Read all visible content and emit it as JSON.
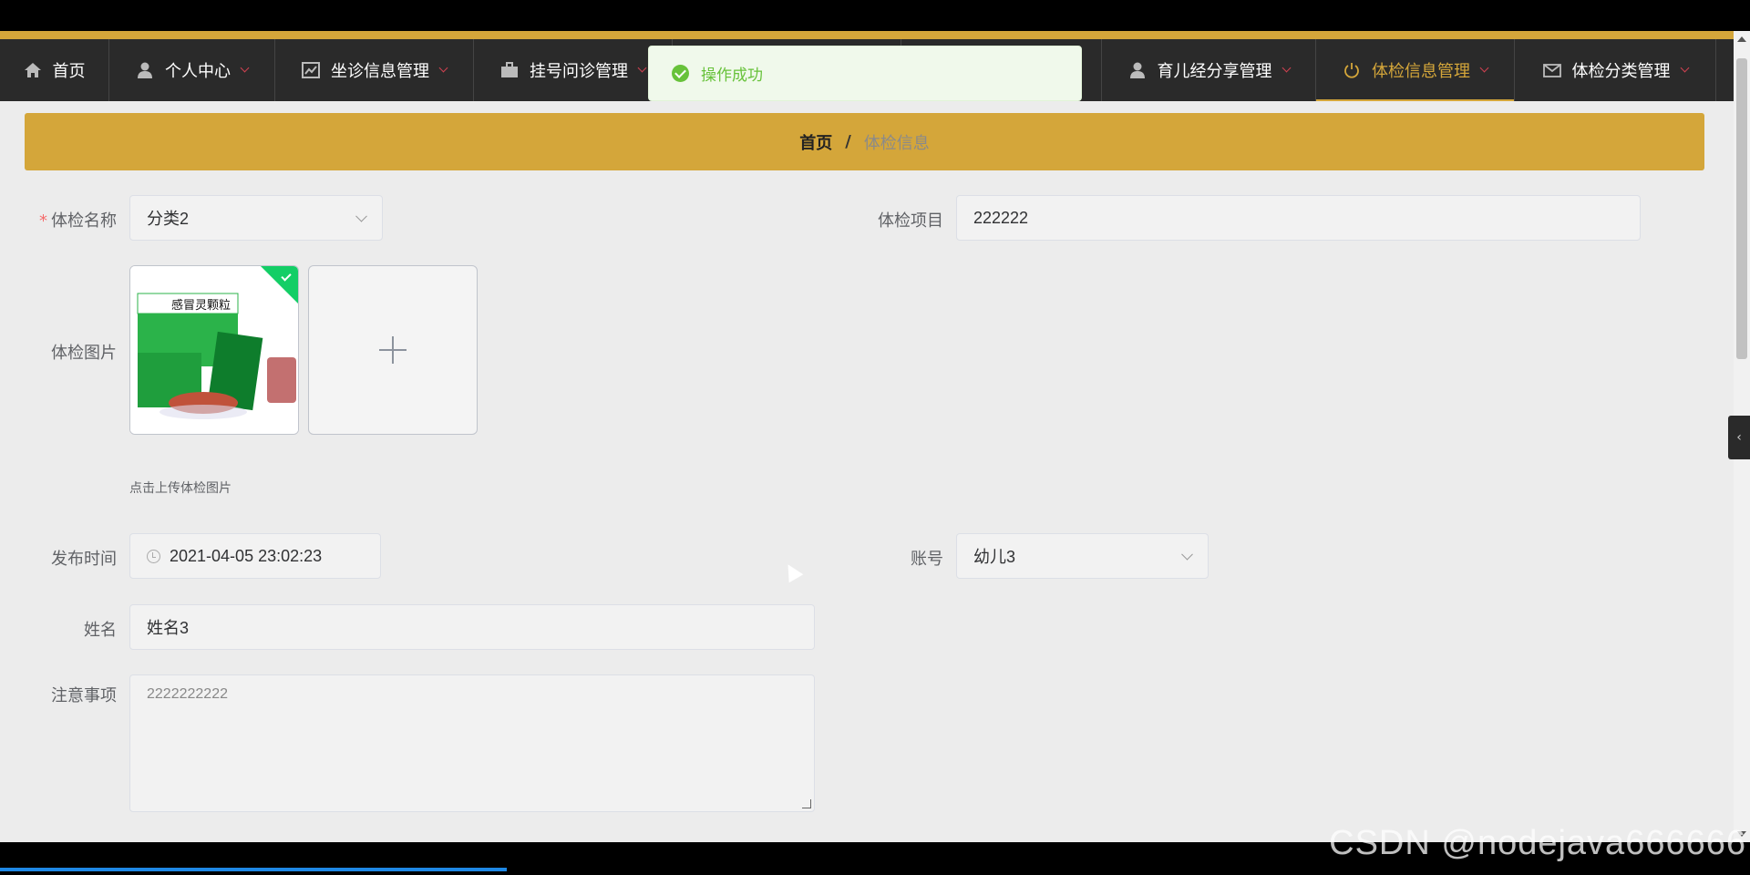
{
  "nav": {
    "items": [
      {
        "label": "首页",
        "icon": "home-icon",
        "active": false
      },
      {
        "label": "个人中心",
        "icon": "user-icon",
        "active": false
      },
      {
        "label": "坐诊信息管理",
        "icon": "chart-icon",
        "active": false
      },
      {
        "label": "挂号问诊管理",
        "icon": "briefcase-icon",
        "active": false
      },
      {
        "label": "育儿经分享管理",
        "icon": "user-icon",
        "active": false
      },
      {
        "label": "体检信息管理",
        "icon": "power-icon",
        "active": true
      },
      {
        "label": "体检分类管理",
        "icon": "mail-icon",
        "active": false
      }
    ]
  },
  "toast": {
    "message": "操作成功",
    "icon": "check-circle-icon"
  },
  "breadcrumb": {
    "home": "首页",
    "separator": "/",
    "current": "体检信息"
  },
  "form": {
    "name_label": "体检名称",
    "name_value": "分类2",
    "project_label": "体检项目",
    "project_value": "222222",
    "image_label": "体检图片",
    "image_hint": "点击上传体检图片",
    "time_label": "发布时间",
    "time_value": "2021-04-05 23:02:23",
    "account_label": "账号",
    "account_value": "幼儿3",
    "fullname_label": "姓名",
    "fullname_value": "姓名3",
    "notes_label": "注意事项",
    "notes_value": "2222222222"
  },
  "thumbnail_text": "感冒灵颗粒",
  "watermark": "CSDN @nodejava666666",
  "colors": {
    "accent": "#d4a63a",
    "navbar": "#2a2a2a",
    "success": "#67c23a",
    "required": "#f56c6c"
  }
}
